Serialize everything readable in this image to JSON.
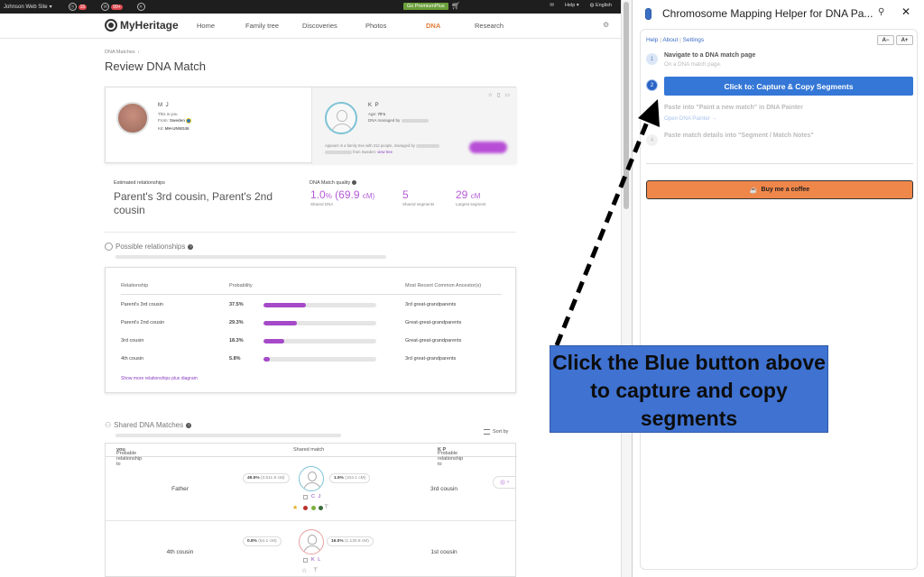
{
  "topbar": {
    "site": "Johnson Web Site",
    "badges": [
      "15",
      "99+"
    ],
    "premium": "Go PremiumPlus",
    "help": "Help",
    "language": "English"
  },
  "nav": {
    "brand": "MyHeritage",
    "items": [
      "Home",
      "Family tree",
      "Discoveries",
      "Photos",
      "DNA",
      "Research"
    ]
  },
  "page": {
    "breadcrumb": "DNA Matches",
    "title": "Review DNA Match"
  },
  "person1": {
    "initials": "M J",
    "this_is_you": "This is you",
    "from_label": "From:",
    "from": "Sweden",
    "kit_label": "Kit:",
    "kit": "MH-UNW245"
  },
  "person2": {
    "initials": "K P",
    "age_label": "Age:",
    "age": "70's",
    "managed_label": "DNA managed by",
    "appears": "Appears in a family tree with 312 people, managed by",
    "from_sweden": "from Sweden:",
    "view_tree": "view tree"
  },
  "estimate": {
    "label": "Estimated relationships",
    "value": "Parent's 3rd cousin, Parent's 2nd cousin"
  },
  "quality": {
    "label": "DNA Match quality",
    "shared_pct": "1.0",
    "shared_cm": "(69.9",
    "shared_label": "Shared DNA",
    "segments": "5",
    "segments_label": "Shared segments",
    "largest": "29",
    "largest_label": "Largest segment",
    "unit_pct": "%",
    "unit_cm": "cM)",
    "unit_cm2": "cM"
  },
  "possible": {
    "title": "Possible relationships",
    "headers": [
      "Relationship",
      "Probability",
      "Most Recent Common Ancestor(s)"
    ],
    "rows": [
      {
        "rel": "Parent's 3rd cousin",
        "prob": "37.5%",
        "pct": 37.5,
        "mrca": "3rd great-grandparents"
      },
      {
        "rel": "Parent's 2nd cousin",
        "prob": "29.3%",
        "pct": 29.3,
        "mrca": "Great-great-grandparents"
      },
      {
        "rel": "3rd cousin",
        "prob": "18.3%",
        "pct": 18.3,
        "mrca": "Great-great-grandparents"
      },
      {
        "rel": "4th cousin",
        "prob": "5.8%",
        "pct": 5.8,
        "mrca": "3rd great-grandparents"
      }
    ],
    "show_more": "Show more relationships plus diagram"
  },
  "shared": {
    "title": "Shared DNA Matches",
    "sort": "Sort by",
    "col_you_prefix": "Probable relationship to",
    "col_you": "you",
    "col_mid": "Shared match",
    "col_kp_prefix": "Probable relationship to",
    "col_kp": "K P",
    "rows": [
      {
        "you": "Father",
        "left_pct": "49.5%",
        "left_cm": "(3,511.9 cM)",
        "right_pct": "1.5%",
        "right_cm": "(104.1 cM)",
        "name": "C J",
        "kp": "3rd cousin"
      },
      {
        "you": "4th cousin",
        "left_pct": "0.8%",
        "left_cm": "(54.1 cM)",
        "right_pct": "16.0%",
        "right_cm": "(1,130.8 cM)",
        "name": "K L",
        "kp": "1st cousin"
      }
    ]
  },
  "panel": {
    "title": "Chromosome Mapping Helper for DNA Pa...",
    "help": "Help",
    "about": "About",
    "settings": "Settings",
    "font_minus": "A−",
    "font_plus": "A+",
    "steps": [
      {
        "num": "1",
        "title": "Navigate to a DNA match page",
        "sub": "On a DNA match page."
      },
      {
        "num": "2",
        "button": "Click to: Capture & Copy Segments"
      },
      {
        "num": "3",
        "title": "Paste into \"Paint a new match\" in DNA Painter",
        "sub": "Open DNA Painter →"
      },
      {
        "num": "4",
        "title": "Paste match details into \"Segment / Match Notes\""
      }
    ],
    "coffee": "Buy me a coffee"
  },
  "annotation": {
    "text": "Click the Blue button above to capture and copy segments"
  },
  "colors": {
    "accent_purple": "#a649c9",
    "blue_button": "#3477d6",
    "coffee_orange": "#f0874a",
    "callout_blue": "#3f72d1",
    "dna_orange": "#e07b39"
  }
}
